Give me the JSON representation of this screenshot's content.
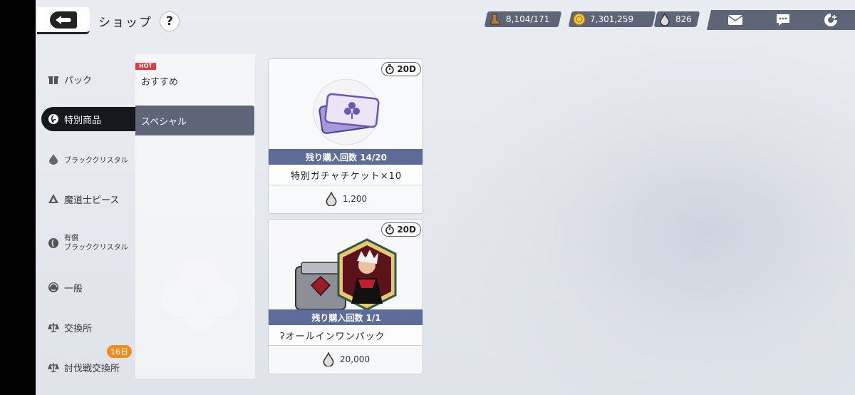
{
  "header": {
    "title": "ショップ",
    "help_label": "?",
    "resources": {
      "stamina": "8,104/171",
      "gold": "7,301,259",
      "crystal": "826"
    },
    "icons": [
      "mail-icon",
      "chat-icon",
      "menu-icon"
    ]
  },
  "sidebar": {
    "items": [
      {
        "label": "パック",
        "icon": "gift-icon"
      },
      {
        "label": "特別商品",
        "icon": "special-icon"
      },
      {
        "label": "ブラッククリスタル",
        "icon": "crystal-icon"
      },
      {
        "label": "魔道士ピース",
        "icon": "piece-icon"
      },
      {
        "label_line1": "有償",
        "label_line2": "ブラッククリスタル",
        "icon": "paid-crystal-icon"
      },
      {
        "label": "一般",
        "icon": "general-icon"
      },
      {
        "label": "交換所",
        "icon": "exchange-icon"
      },
      {
        "label": "討伐戦交換所",
        "icon": "exchange-icon",
        "badge": "16日"
      }
    ],
    "active_index": 1
  },
  "subcategories": {
    "hot_badge": "HOT",
    "items": [
      {
        "label": "おすすめ"
      },
      {
        "label": "スペシャル"
      }
    ],
    "active_index": 1
  },
  "products": [
    {
      "timer": "20D",
      "limit": "残り購入回数 14/20",
      "name": "特別ガチャチケット×10",
      "price": "1,200"
    },
    {
      "timer": "20D",
      "limit": "残り購入回数 1/1",
      "name": "ʔオールインワンパック",
      "price": "20,000"
    }
  ],
  "colors": {
    "accent": "#5d6577",
    "limit_bar": "#5d6c99",
    "hot": "#e2393b",
    "badge": "#f08c1e"
  }
}
